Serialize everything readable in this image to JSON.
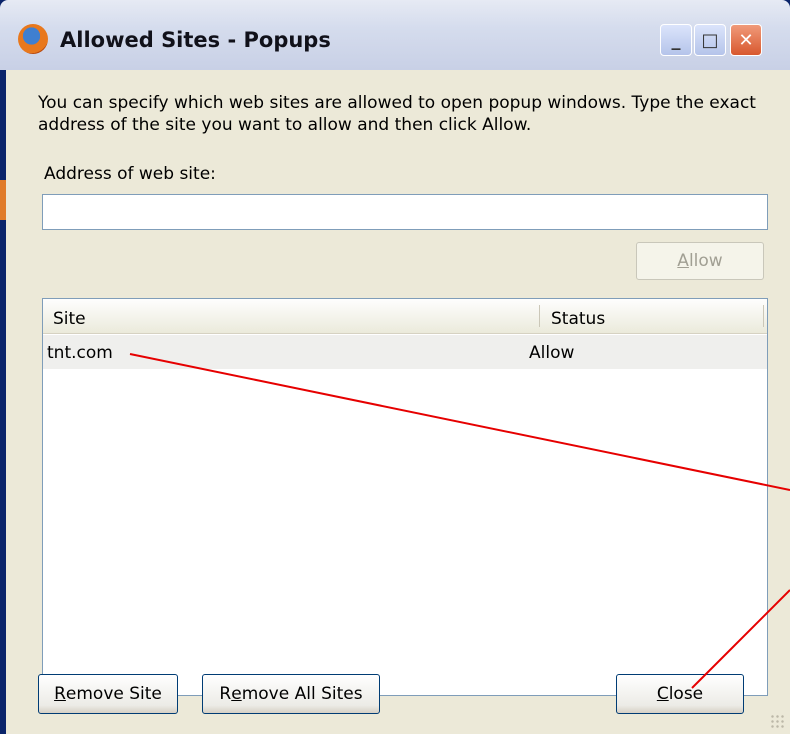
{
  "window": {
    "title": "Allowed Sites - Popups",
    "controls": {
      "minimize": "_",
      "maximize": "□",
      "close": "✕"
    }
  },
  "dialog": {
    "description": "You can specify which web sites are allowed to open popup windows. Type the exact address of the site you want to allow and then click Allow.",
    "address_label": "Address of web site:",
    "address_value": "",
    "allow_button_accel": "A",
    "allow_button_rest": "llow"
  },
  "list": {
    "columns": [
      "Site",
      "Status"
    ],
    "rows": [
      {
        "site": "tnt.com",
        "status": "Allow"
      }
    ]
  },
  "buttons": {
    "remove_site_accel": "R",
    "remove_site_rest": "emove Site",
    "remove_all_pre": "R",
    "remove_all_accel": "e",
    "remove_all_rest": "move All Sites",
    "close_accel": "C",
    "close_rest": "lose"
  },
  "colors": {
    "annotation_line": "#e60000",
    "dialog_bg": "#ece9d8"
  },
  "icons": {
    "app": "firefox-icon"
  }
}
